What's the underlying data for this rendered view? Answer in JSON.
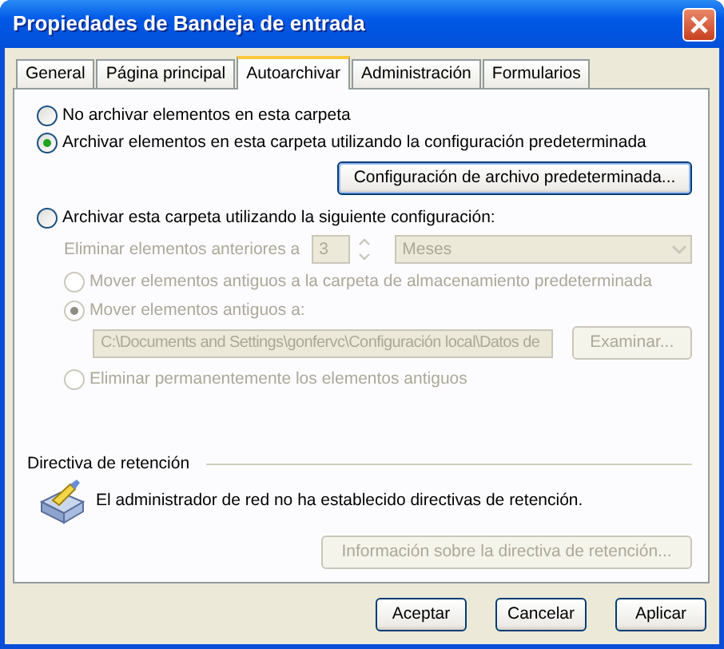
{
  "window": {
    "title": "Propiedades de Bandeja de entrada"
  },
  "tabs": [
    {
      "label": "General",
      "selected": false
    },
    {
      "label": "Página principal",
      "selected": false
    },
    {
      "label": "Autoarchivar",
      "selected": true
    },
    {
      "label": "Administración",
      "selected": false
    },
    {
      "label": "Formularios",
      "selected": false
    }
  ],
  "archive_options": [
    {
      "label": "No archivar elementos en esta carpeta",
      "selected": false
    },
    {
      "label": "Archivar elementos en esta carpeta utilizando la configuración predeterminada",
      "selected": true
    }
  ],
  "default_settings_button": {
    "label": "Configuración de archivo predeterminada..."
  },
  "custom": {
    "label": "Archivar esta carpeta utilizando la siguiente configuración:",
    "selected": false,
    "disabled": true,
    "age_label": "Eliminar elementos anteriores a",
    "age_value": "3",
    "age_unit": "Meses",
    "disposal_options": [
      {
        "kind": "radio",
        "label": "Mover elementos antiguos a la carpeta de almacenamiento predeterminada",
        "selected": false
      },
      {
        "kind": "radio",
        "label": "Mover elementos antiguos a:",
        "selected": true
      },
      {
        "kind": "folder",
        "path": "C:\\Documents and Settings\\gonfervc\\Configuración local\\Datos de",
        "browse": "Examinar..."
      },
      {
        "kind": "radio",
        "label": "Eliminar permanentemente los elementos antiguos",
        "selected": false
      }
    ]
  },
  "retention": {
    "heading": "Directiva de retención",
    "message": "El administrador de red no ha establecido directivas de retención.",
    "info_button": {
      "label": "Información sobre la directiva de retención...",
      "disabled": true
    }
  },
  "buttons": [
    {
      "label": "Aceptar"
    },
    {
      "label": "Cancelar"
    },
    {
      "label": "Aplicar"
    }
  ]
}
